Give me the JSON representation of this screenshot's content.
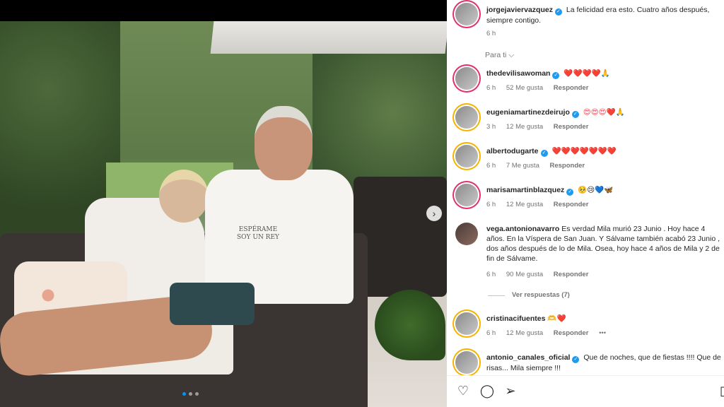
{
  "post": {
    "author": "jorgejaviervazquez",
    "caption": "La felicidad era esto. Cuatro años después, siempre contigo.",
    "time": "6 h",
    "shirt_print": "ESPÉRAME SOY UN REY"
  },
  "filter_label": "Para ti",
  "comments": [
    {
      "user": "thedevilisawoman",
      "text": "❤️❤️❤️❤️🙏",
      "time": "6 h",
      "likes": "52 Me gusta",
      "reply": "Responder"
    },
    {
      "user": "eugeniamartinezdeirujo",
      "text": "😍😍😍❤️🙏",
      "time": "3 h",
      "likes": "12 Me gusta",
      "reply": "Responder"
    },
    {
      "user": "albertodugarte",
      "text": "❤️❤️❤️❤️❤️❤️❤️",
      "time": "6 h",
      "likes": "7 Me gusta",
      "reply": "Responder"
    },
    {
      "user": "marisamartinblazquez",
      "text": "🥺😢💙🦋",
      "time": "6 h",
      "likes": "12 Me gusta",
      "reply": "Responder"
    },
    {
      "user": "vega.antonionavarro",
      "text": "Es verdad Mila murió 23 Junio . Hoy hace 4 años. En la Víspera de San Juan. Y Sálvame también acabó 23 Junio , dos años después de lo de Mila. Osea, hoy hace 4 años de Mila y 2 de fin de Sálvame.",
      "time": "6 h",
      "likes": "90 Me gusta",
      "reply": "Responder",
      "view_replies": "Ver respuestas (7)"
    },
    {
      "user": "cristinacifuentes",
      "text": "🫶❤️",
      "time": "6 h",
      "likes": "12 Me gusta",
      "reply": "Responder",
      "more": "•••"
    },
    {
      "user": "antonio_canales_oficial",
      "text": "Que de noches, que de fiestas !!!! Que de risas... Mila siempre !!!"
    }
  ],
  "icons": {
    "like": "heart-icon",
    "comment": "comment-icon",
    "share": "send-icon",
    "save": "bookmark-icon",
    "next": "chevron-right-icon"
  },
  "colors": {
    "verified": "#1d9bf0",
    "heart": "#ed4956",
    "carousel_active": "#0095f6"
  }
}
